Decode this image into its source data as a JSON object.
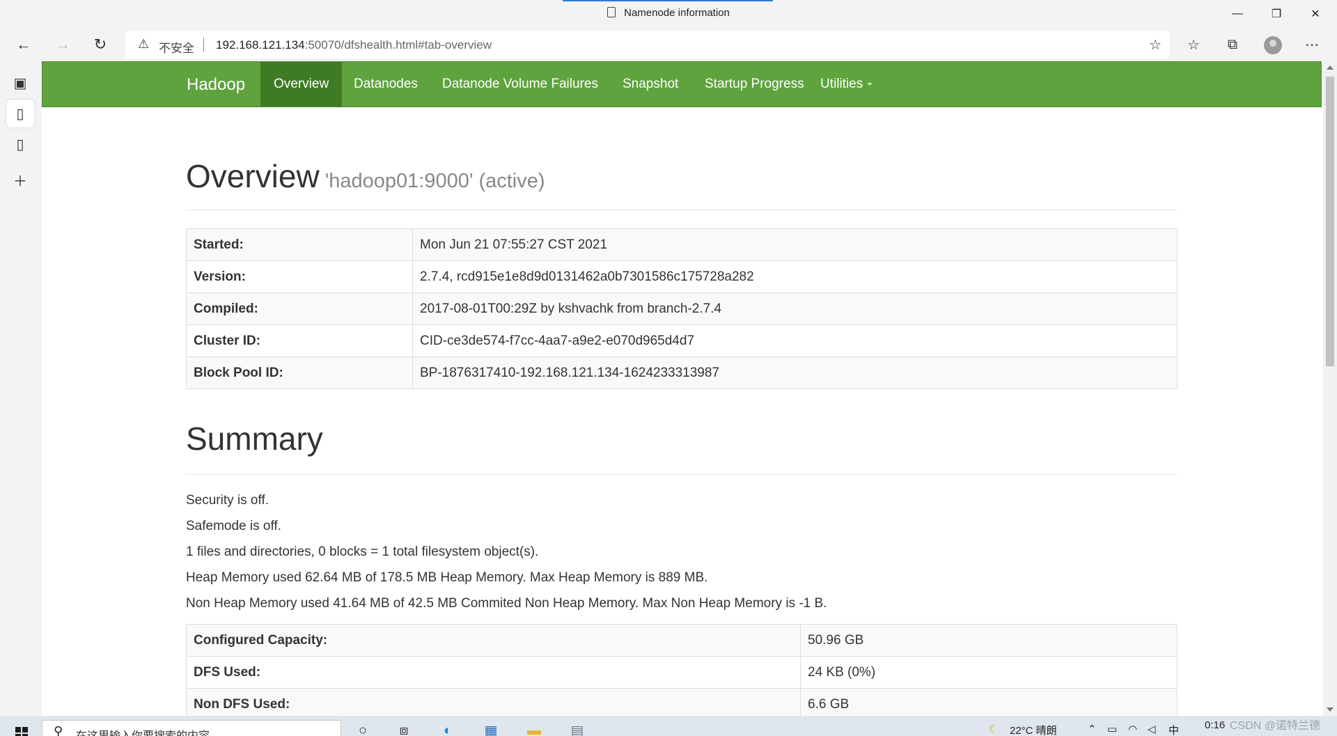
{
  "window": {
    "title": "Namenode information",
    "controls": [
      "minimize",
      "restore",
      "close"
    ]
  },
  "browser": {
    "security_label": "不安全",
    "url_host": "192.168.121.134",
    "url_rest": ":50070/dfshealth.html#tab-overview",
    "icons": {
      "back": "back-arrow-icon",
      "forward": "forward-arrow-icon",
      "refresh": "refresh-icon",
      "warning": "warning-icon",
      "favorite_add": "star-plus-icon",
      "favorites": "favorites-icon",
      "collections": "collections-icon",
      "profile": "avatar",
      "more": "more-icon"
    }
  },
  "sidebar": {
    "items": [
      "tab-actions-icon",
      "page-icon",
      "page-icon",
      "plus-icon"
    ]
  },
  "navbar": {
    "brand": "Hadoop",
    "items": [
      {
        "label": "Overview",
        "active": true
      },
      {
        "label": "Datanodes",
        "active": false
      },
      {
        "label": "Datanode Volume Failures",
        "active": false
      },
      {
        "label": "Snapshot",
        "active": false
      },
      {
        "label": "Startup Progress",
        "active": false
      },
      {
        "label": "Utilities",
        "active": false,
        "dropdown": true
      }
    ]
  },
  "overview": {
    "heading": "Overview",
    "subheading": "'hadoop01:9000' (active)",
    "rows": [
      {
        "key": "Started:",
        "value": "Mon Jun 21 07:55:27 CST 2021"
      },
      {
        "key": "Version:",
        "value": "2.7.4, rcd915e1e8d9d0131462a0b7301586c175728a282"
      },
      {
        "key": "Compiled:",
        "value": "2017-08-01T00:29Z by kshvachk from branch-2.7.4"
      },
      {
        "key": "Cluster ID:",
        "value": "CID-ce3de574-f7cc-4aa7-a9e2-e070d965d4d7"
      },
      {
        "key": "Block Pool ID:",
        "value": "BP-1876317410-192.168.121.134-1624233313987"
      }
    ]
  },
  "summary": {
    "heading": "Summary",
    "lines": [
      "Security is off.",
      "Safemode is off.",
      "1 files and directories, 0 blocks = 1 total filesystem object(s).",
      "Heap Memory used 62.64 MB of 178.5 MB Heap Memory. Max Heap Memory is 889 MB.",
      "Non Heap Memory used 41.64 MB of 42.5 MB Commited Non Heap Memory. Max Non Heap Memory is -1 B."
    ],
    "rows": [
      {
        "key": "Configured Capacity:",
        "value": "50.96 GB"
      },
      {
        "key": "DFS Used:",
        "value": "24 KB (0%)"
      },
      {
        "key": "Non DFS Used:",
        "value": "6.6 GB"
      }
    ]
  },
  "taskbar": {
    "search_placeholder": "在这里输入你要搜索的内容",
    "weather": "22°C 晴朗",
    "ime": "中",
    "clock": "0:16"
  },
  "watermark": "CSDN @诺特兰德"
}
